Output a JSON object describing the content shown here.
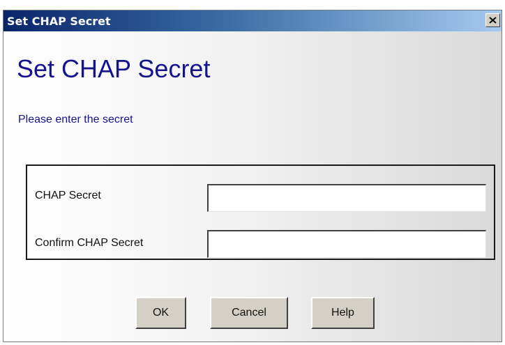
{
  "window": {
    "title": "Set CHAP Secret",
    "close_glyph": "close-icon"
  },
  "dialog": {
    "heading": "Set CHAP Secret",
    "instructions": "Please enter the secret"
  },
  "form": {
    "secret": {
      "label": "CHAP Secret",
      "value": ""
    },
    "confirm": {
      "label": "Confirm CHAP Secret",
      "value": ""
    }
  },
  "buttons": {
    "ok": "OK",
    "cancel": "Cancel",
    "help": "Help"
  },
  "colors": {
    "heading": "#14148c",
    "titlebar_start": "#0a246a",
    "titlebar_end": "#a6caf0"
  }
}
